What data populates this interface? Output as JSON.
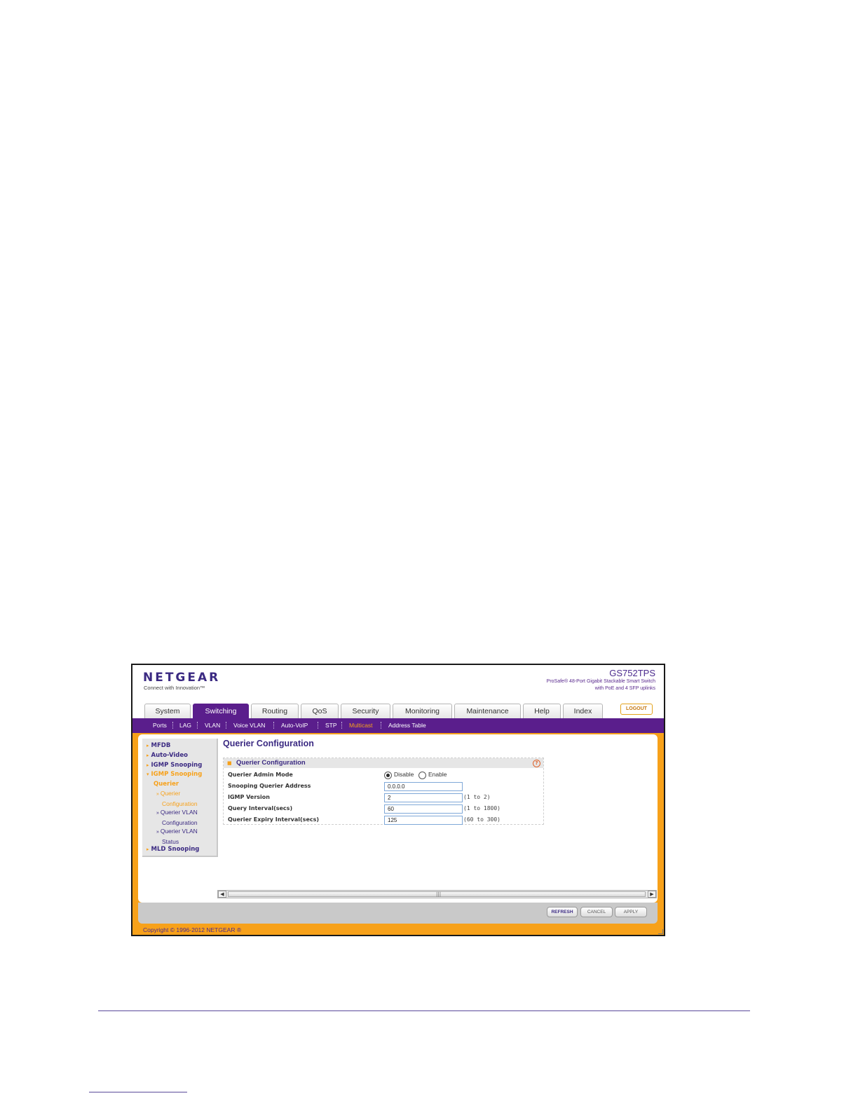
{
  "brand": {
    "logo": "NETGEAR",
    "tagline": "Connect with Innovation™"
  },
  "product": {
    "model": "GS752TPS",
    "description_line1": "ProSafe® 48-Port Gigabit Stackable Smart Switch",
    "description_line2": "with PoE and 4 SFP uplinks"
  },
  "tabs": [
    {
      "label": "System"
    },
    {
      "label": "Switching",
      "active": true
    },
    {
      "label": "Routing"
    },
    {
      "label": "QoS"
    },
    {
      "label": "Security"
    },
    {
      "label": "Monitoring"
    },
    {
      "label": "Maintenance"
    },
    {
      "label": "Help"
    },
    {
      "label": "Index"
    }
  ],
  "logout_label": "LOGOUT",
  "subnav": [
    {
      "label": "Ports"
    },
    {
      "label": "LAG"
    },
    {
      "label": "VLAN"
    },
    {
      "label": "Voice VLAN"
    },
    {
      "label": "Auto-VoIP"
    },
    {
      "label": "STP"
    },
    {
      "label": "Multicast",
      "active": true
    },
    {
      "label": "Address Table"
    }
  ],
  "sidebar": {
    "items": [
      {
        "label": "MFDB"
      },
      {
        "label": "Auto-Video"
      },
      {
        "label": "IGMP Snooping"
      },
      {
        "label": "IGMP Snooping",
        "expanded": true
      }
    ],
    "group_label": "Querier",
    "subitems": [
      {
        "label_line1": "Querier",
        "label_line2": "Configuration",
        "active": true
      },
      {
        "label_line1": "Querier VLAN",
        "label_line2": "Configuration"
      },
      {
        "label_line1": "Querier VLAN",
        "label_line2": "Status"
      }
    ],
    "last_item": "MLD Snooping"
  },
  "page": {
    "title": "Querier Configuration",
    "panel_title": "Querier Configuration",
    "help_icon": "help-icon"
  },
  "form": {
    "admin_mode": {
      "label": "Querier Admin Mode",
      "options": [
        "Disable",
        "Enable"
      ],
      "selected": "Disable"
    },
    "querier_address": {
      "label": "Snooping Querier Address",
      "value": "0.0.0.0"
    },
    "igmp_version": {
      "label": "IGMP Version",
      "value": "2",
      "range": "(1 to 2)"
    },
    "query_interval": {
      "label": "Query Interval(secs)",
      "value": "60",
      "range": "(1 to 1800)"
    },
    "expiry_interval": {
      "label": "Querier Expiry Interval(secs)",
      "value": "125",
      "range": "(60 to 300)"
    }
  },
  "buttons": {
    "refresh": "REFRESH",
    "cancel": "CANCEL",
    "apply": "APPLY"
  },
  "footer": {
    "copyright": "Copyright © 1996-2012 NETGEAR ®"
  },
  "colors": {
    "brand_purple": "#5a1e8c",
    "accent_orange": "#f7a11a"
  }
}
